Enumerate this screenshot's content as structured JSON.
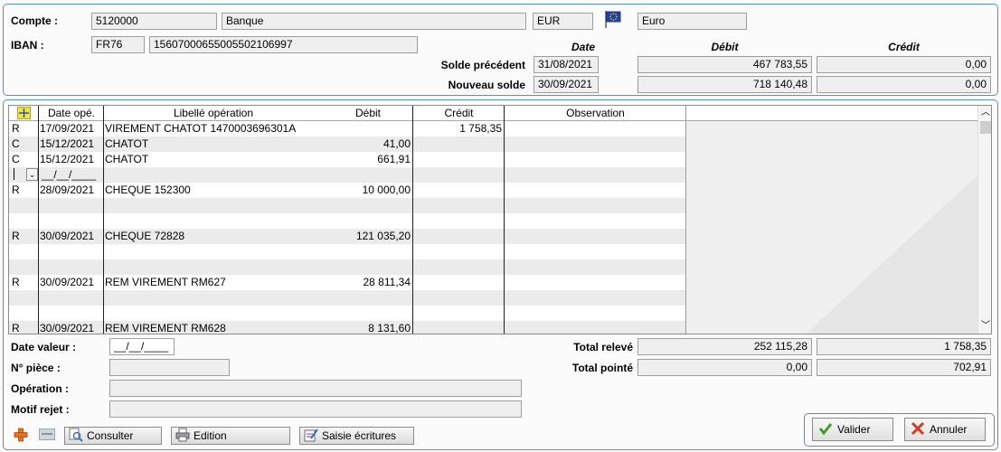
{
  "header": {
    "compte_label": "Compte :",
    "compte_number": "5120000",
    "compte_name": "Banque",
    "currency_code": "EUR",
    "currency_name": "Euro",
    "iban_label": "IBAN :",
    "iban_country": "FR76",
    "iban_number": "15607000655005502106997",
    "col_date": "Date",
    "col_debit": "Débit",
    "col_credit": "Crédit",
    "solde_precedent_label": "Solde précédent",
    "solde_precedent_date": "31/08/2021",
    "solde_precedent_debit": "467 783,55",
    "solde_precedent_credit": "0,00",
    "nouveau_solde_label": "Nouveau solde",
    "nouveau_solde_date": "30/09/2021",
    "nouveau_solde_debit": "718 140,48",
    "nouveau_solde_credit": "0,00"
  },
  "grid": {
    "columns": [
      "Date opé.",
      "Libellé opération",
      "Débit",
      "Crédit",
      "Observation"
    ],
    "rows": [
      {
        "flag": "R",
        "date": "17/09/2021",
        "libelle": "VIREMENT CHATOT 1470003696301A",
        "debit": "",
        "credit": "1 758,35"
      },
      {
        "flag": "C",
        "date": "15/12/2021",
        "libelle": "CHATOT",
        "debit": "41,00",
        "credit": ""
      },
      {
        "flag": "C",
        "date": "15/12/2021",
        "libelle": "CHATOT",
        "debit": "661,91",
        "credit": ""
      },
      {
        "flag": "",
        "date": "__/__/____",
        "libelle": "",
        "debit": "",
        "credit": ""
      },
      {
        "flag": "R",
        "date": "28/09/2021",
        "libelle": "CHEQUE 152300",
        "debit": "10 000,00",
        "credit": ""
      },
      {
        "flag": "",
        "date": "",
        "libelle": "",
        "debit": "",
        "credit": ""
      },
      {
        "flag": "",
        "date": "",
        "libelle": "",
        "debit": "",
        "credit": ""
      },
      {
        "flag": "R",
        "date": "30/09/2021",
        "libelle": "CHEQUE 72828",
        "debit": "121 035,20",
        "credit": ""
      },
      {
        "flag": "",
        "date": "",
        "libelle": "",
        "debit": "",
        "credit": ""
      },
      {
        "flag": "",
        "date": "",
        "libelle": "",
        "debit": "",
        "credit": ""
      },
      {
        "flag": "R",
        "date": "30/09/2021",
        "libelle": "REM VIREMENT RM627",
        "debit": "28 811,34",
        "credit": ""
      },
      {
        "flag": "",
        "date": "",
        "libelle": "",
        "debit": "",
        "credit": ""
      },
      {
        "flag": "",
        "date": "",
        "libelle": "",
        "debit": "",
        "credit": ""
      },
      {
        "flag": "R",
        "date": "30/09/2021",
        "libelle": "REM VIREMENT RM628",
        "debit": "8 131,60",
        "credit": ""
      }
    ]
  },
  "footer": {
    "date_valeur_label": "Date valeur :",
    "date_valeur_value": "__/__/____",
    "piece_label": "N° pièce :",
    "operation_label": "Opération :",
    "motif_label": "Motif rejet :",
    "total_releve_label": "Total relevé",
    "total_releve_debit": "252 115,28",
    "total_releve_credit": "1 758,35",
    "total_pointe_label": "Total pointé",
    "total_pointe_debit": "0,00",
    "total_pointe_credit": "702,91",
    "consulter_label": "Consulter",
    "edition_label": "Edition",
    "saisie_label": "Saisie écritures",
    "valider_label": "Valider",
    "annuler_label": "Annuler"
  },
  "icons": {
    "flag": "eu-flag-icon",
    "add_row": "add-row-icon",
    "add": "plus-icon",
    "card": "card-icon",
    "consulter": "magnifier-icon",
    "edition": "printer-icon",
    "saisie": "edit-entries-icon",
    "valider": "checkmark-icon",
    "annuler": "cross-icon"
  },
  "colors": {
    "panel_border": "#5a8fb8",
    "row_stripe": "#ebebeb",
    "valider_green": "#3f9b2a",
    "annuler_red": "#d23a2a"
  }
}
